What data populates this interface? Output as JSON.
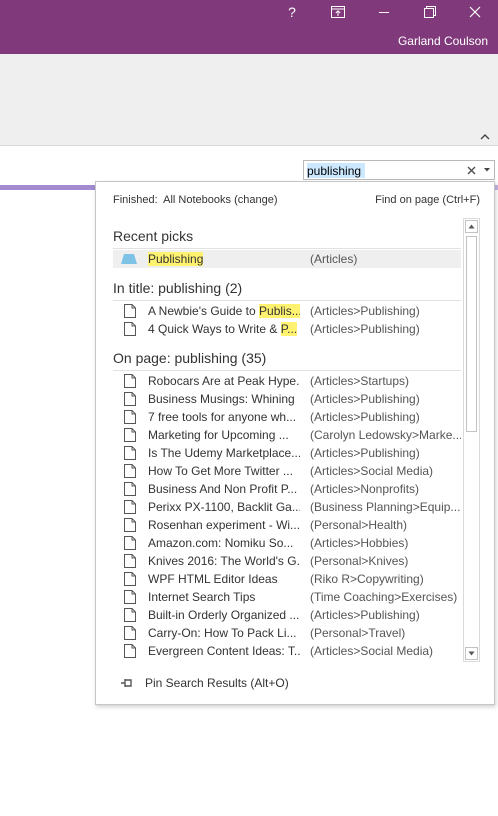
{
  "titlebar": {
    "help_label": "?",
    "user_name": "Garland Coulson",
    "controls": [
      "help-icon",
      "fullscreen-icon",
      "minimize-icon",
      "restore-icon",
      "close-icon"
    ]
  },
  "search": {
    "value": "publishing"
  },
  "panel": {
    "finished_label": "Finished:",
    "scope_label": "All Notebooks (change)",
    "find_on_page": "Find on page (Ctrl+F)",
    "recent_picks_title": "Recent picks",
    "recent_picks": [
      {
        "pre": "",
        "hl": "Publishing",
        "post": "",
        "loc": "(Articles)"
      }
    ],
    "in_title_title": "In title:  publishing (2)",
    "in_title": [
      {
        "pre": "A Newbie's Guide to ",
        "hl": "Publis...",
        "post": "",
        "loc": "(Articles>Publishing)"
      },
      {
        "pre": "4 Quick Ways to Write & ",
        "hl": "P...",
        "post": "",
        "loc": "(Articles>Publishing)"
      }
    ],
    "on_page_title": "On page:  publishing (35)",
    "on_page": [
      {
        "title": "Robocars Are at Peak Hype...",
        "loc": "(Articles>Startups)"
      },
      {
        "title": "Business Musings: Whining",
        "loc": "(Articles>Publishing)"
      },
      {
        "title": "7 free tools for anyone wh...",
        "loc": "(Articles>Publishing)"
      },
      {
        "title": "Marketing for Upcoming ...",
        "loc": "(Carolyn Ledowsky>Marke..."
      },
      {
        "title": "Is The Udemy Marketplace...",
        "loc": "(Articles>Publishing)"
      },
      {
        "title": "How To Get More Twitter ...",
        "loc": "(Articles>Social Media)"
      },
      {
        "title": "Business And Non Profit P...",
        "loc": "(Articles>Nonprofits)"
      },
      {
        "title": "Perixx PX-1100, Backlit Ga...",
        "loc": "(Business Planning>Equip..."
      },
      {
        "title": "Rosenhan experiment - Wi...",
        "loc": "(Personal>Health)"
      },
      {
        "title": "Amazon.com: Nomiku So...",
        "loc": "(Articles>Hobbies)"
      },
      {
        "title": "Knives 2016: The World's G...",
        "loc": "(Personal>Knives)"
      },
      {
        "title": "WPF HTML Editor Ideas",
        "loc": "(Riko R>Copywriting)"
      },
      {
        "title": "Internet Search Tips",
        "loc": "(Time Coaching>Exercises)"
      },
      {
        "title": "Built-in Orderly Organized ...",
        "loc": "(Articles>Publishing)"
      },
      {
        "title": "Carry-On: How To Pack Li...",
        "loc": "(Personal>Travel)"
      },
      {
        "title": "Evergreen Content Ideas: T...",
        "loc": "(Articles>Social Media)"
      }
    ],
    "pin_label": "Pin Search Results (Alt+O)"
  },
  "colors": {
    "titlebar": "#80397b",
    "highlight": "#fff270",
    "page_tab": "#a28bd0"
  }
}
